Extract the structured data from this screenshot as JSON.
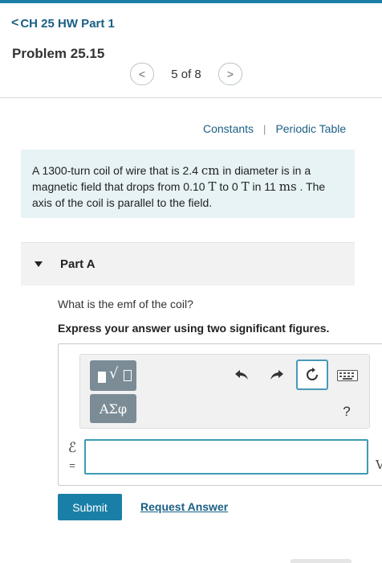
{
  "header": {
    "back_chevron": "<",
    "back_label": "CH 25 HW Part 1",
    "problem_title": "Problem 25.15",
    "pager": {
      "prev": "<",
      "text": "5 of 8",
      "next": ">"
    }
  },
  "links": {
    "constants": "Constants",
    "divider": "|",
    "periodic_table": "Periodic Table"
  },
  "problem_statement": {
    "p1": "A 1300-turn coil of wire that is 2.4 ",
    "u1": "cm",
    "p2": " in diameter is in a magnetic field that drops from 0.10 ",
    "u2": "T",
    "p3": " to 0 ",
    "u3": "T",
    "p4": " in 11 ",
    "u4": "ms",
    "p5": " . The axis of the coil is parallel to the field."
  },
  "part": {
    "label": "Part A",
    "question": "What is the emf of the coil?",
    "instruction": "Express your answer using two significant figures."
  },
  "toolbar": {
    "greek_label": "ΑΣφ",
    "help_label": "?"
  },
  "answer": {
    "symbol": "ℰ",
    "equals": "=",
    "value": "",
    "unit": "V"
  },
  "actions": {
    "submit": "Submit",
    "request_answer": "Request Answer"
  },
  "colors": {
    "accent": "#1a7fa7",
    "link": "#1a5f84",
    "info_bg": "#e7f3f5",
    "toolbar_button": "#7c8c96"
  }
}
